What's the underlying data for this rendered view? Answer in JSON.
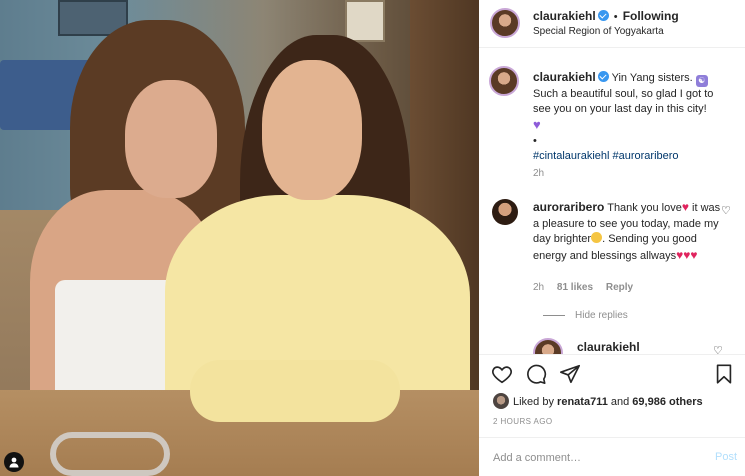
{
  "header": {
    "username": "claurakiehl",
    "separator": "•",
    "follow_label": "Following",
    "location": "Special Region of Yogyakarta"
  },
  "caption": {
    "username": "claurakiehl",
    "text_part1": "Yin Yang sisters.",
    "text_part2": "Such a beautiful soul, so glad I got to see you on your last day in this city!",
    "bullet": "•",
    "hashtags": "#cintalaurakiehl #auroraribero",
    "time": "2h"
  },
  "comment": {
    "username": "auroraribero",
    "text_part1": "Thank you love",
    "text_part2": "it was a pleasure to see you today, made my day brighter",
    "text_part3": ". Sending you good energy and blessings allways",
    "time": "2h",
    "likes": "81 likes",
    "reply_label": "Reply",
    "hide_replies": "Hide replies"
  },
  "reply_peek": {
    "username": "claurakiehl"
  },
  "actions": {
    "liked_by_prefix": "Liked by",
    "liked_by_user": "renata711",
    "liked_by_and": "and",
    "others": "69,986 others",
    "time_ago": "2 HOURS AGO",
    "comment_placeholder": "Add a comment…",
    "post_label": "Post"
  },
  "colors": {
    "verified": "#3897f0",
    "link": "#00376b",
    "secondary_text": "#8e8e8e",
    "post_disabled": "#b2dffc",
    "red_heart": "#e0245e"
  },
  "icons": [
    "heart-icon",
    "comment-icon",
    "share-icon",
    "bookmark-icon",
    "verified-icon",
    "user-tag-icon"
  ]
}
